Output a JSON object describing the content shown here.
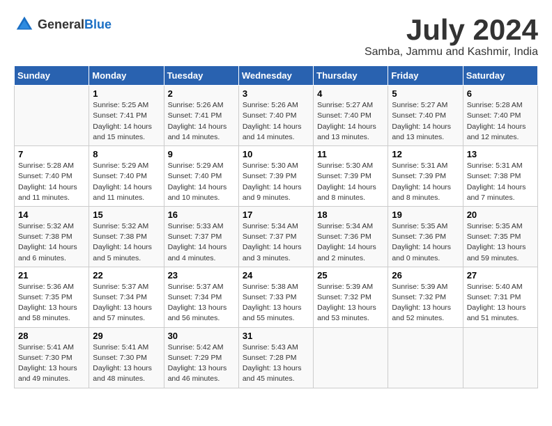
{
  "header": {
    "logo_general": "General",
    "logo_blue": "Blue",
    "month_year": "July 2024",
    "location": "Samba, Jammu and Kashmir, India"
  },
  "days_of_week": [
    "Sunday",
    "Monday",
    "Tuesday",
    "Wednesday",
    "Thursday",
    "Friday",
    "Saturday"
  ],
  "weeks": [
    [
      {
        "day": "",
        "info": ""
      },
      {
        "day": "1",
        "info": "Sunrise: 5:25 AM\nSunset: 7:41 PM\nDaylight: 14 hours\nand 15 minutes."
      },
      {
        "day": "2",
        "info": "Sunrise: 5:26 AM\nSunset: 7:41 PM\nDaylight: 14 hours\nand 14 minutes."
      },
      {
        "day": "3",
        "info": "Sunrise: 5:26 AM\nSunset: 7:40 PM\nDaylight: 14 hours\nand 14 minutes."
      },
      {
        "day": "4",
        "info": "Sunrise: 5:27 AM\nSunset: 7:40 PM\nDaylight: 14 hours\nand 13 minutes."
      },
      {
        "day": "5",
        "info": "Sunrise: 5:27 AM\nSunset: 7:40 PM\nDaylight: 14 hours\nand 13 minutes."
      },
      {
        "day": "6",
        "info": "Sunrise: 5:28 AM\nSunset: 7:40 PM\nDaylight: 14 hours\nand 12 minutes."
      }
    ],
    [
      {
        "day": "7",
        "info": "Sunrise: 5:28 AM\nSunset: 7:40 PM\nDaylight: 14 hours\nand 11 minutes."
      },
      {
        "day": "8",
        "info": "Sunrise: 5:29 AM\nSunset: 7:40 PM\nDaylight: 14 hours\nand 11 minutes."
      },
      {
        "day": "9",
        "info": "Sunrise: 5:29 AM\nSunset: 7:40 PM\nDaylight: 14 hours\nand 10 minutes."
      },
      {
        "day": "10",
        "info": "Sunrise: 5:30 AM\nSunset: 7:39 PM\nDaylight: 14 hours\nand 9 minutes."
      },
      {
        "day": "11",
        "info": "Sunrise: 5:30 AM\nSunset: 7:39 PM\nDaylight: 14 hours\nand 8 minutes."
      },
      {
        "day": "12",
        "info": "Sunrise: 5:31 AM\nSunset: 7:39 PM\nDaylight: 14 hours\nand 8 minutes."
      },
      {
        "day": "13",
        "info": "Sunrise: 5:31 AM\nSunset: 7:38 PM\nDaylight: 14 hours\nand 7 minutes."
      }
    ],
    [
      {
        "day": "14",
        "info": "Sunrise: 5:32 AM\nSunset: 7:38 PM\nDaylight: 14 hours\nand 6 minutes."
      },
      {
        "day": "15",
        "info": "Sunrise: 5:32 AM\nSunset: 7:38 PM\nDaylight: 14 hours\nand 5 minutes."
      },
      {
        "day": "16",
        "info": "Sunrise: 5:33 AM\nSunset: 7:37 PM\nDaylight: 14 hours\nand 4 minutes."
      },
      {
        "day": "17",
        "info": "Sunrise: 5:34 AM\nSunset: 7:37 PM\nDaylight: 14 hours\nand 3 minutes."
      },
      {
        "day": "18",
        "info": "Sunrise: 5:34 AM\nSunset: 7:36 PM\nDaylight: 14 hours\nand 2 minutes."
      },
      {
        "day": "19",
        "info": "Sunrise: 5:35 AM\nSunset: 7:36 PM\nDaylight: 14 hours\nand 0 minutes."
      },
      {
        "day": "20",
        "info": "Sunrise: 5:35 AM\nSunset: 7:35 PM\nDaylight: 13 hours\nand 59 minutes."
      }
    ],
    [
      {
        "day": "21",
        "info": "Sunrise: 5:36 AM\nSunset: 7:35 PM\nDaylight: 13 hours\nand 58 minutes."
      },
      {
        "day": "22",
        "info": "Sunrise: 5:37 AM\nSunset: 7:34 PM\nDaylight: 13 hours\nand 57 minutes."
      },
      {
        "day": "23",
        "info": "Sunrise: 5:37 AM\nSunset: 7:34 PM\nDaylight: 13 hours\nand 56 minutes."
      },
      {
        "day": "24",
        "info": "Sunrise: 5:38 AM\nSunset: 7:33 PM\nDaylight: 13 hours\nand 55 minutes."
      },
      {
        "day": "25",
        "info": "Sunrise: 5:39 AM\nSunset: 7:32 PM\nDaylight: 13 hours\nand 53 minutes."
      },
      {
        "day": "26",
        "info": "Sunrise: 5:39 AM\nSunset: 7:32 PM\nDaylight: 13 hours\nand 52 minutes."
      },
      {
        "day": "27",
        "info": "Sunrise: 5:40 AM\nSunset: 7:31 PM\nDaylight: 13 hours\nand 51 minutes."
      }
    ],
    [
      {
        "day": "28",
        "info": "Sunrise: 5:41 AM\nSunset: 7:30 PM\nDaylight: 13 hours\nand 49 minutes."
      },
      {
        "day": "29",
        "info": "Sunrise: 5:41 AM\nSunset: 7:30 PM\nDaylight: 13 hours\nand 48 minutes."
      },
      {
        "day": "30",
        "info": "Sunrise: 5:42 AM\nSunset: 7:29 PM\nDaylight: 13 hours\nand 46 minutes."
      },
      {
        "day": "31",
        "info": "Sunrise: 5:43 AM\nSunset: 7:28 PM\nDaylight: 13 hours\nand 45 minutes."
      },
      {
        "day": "",
        "info": ""
      },
      {
        "day": "",
        "info": ""
      },
      {
        "day": "",
        "info": ""
      }
    ]
  ]
}
